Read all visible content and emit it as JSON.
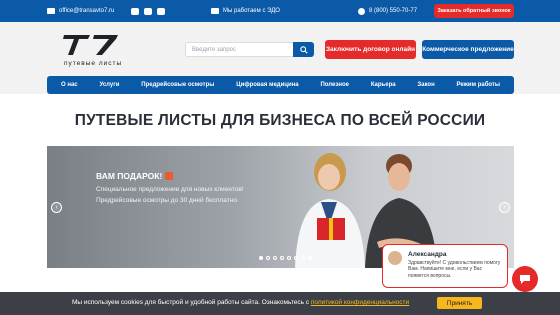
{
  "topbar": {
    "email": "office@transavto7.ru",
    "edo": "Мы работаем с ЭДО",
    "phone": "8 (800) 550-70-77",
    "callback": "Заказать обратный звонок"
  },
  "header": {
    "logo_text": "Т7",
    "logo_sub": "путевые листы",
    "search_placeholder": "Введите запрос",
    "contract_button": "Заключить договор онлайн",
    "offer_button": "Коммерческое предложение"
  },
  "nav": {
    "items": [
      "О нас",
      "Услуги",
      "Предрейсовые осмотры",
      "Цифровая медицина",
      "Полезное",
      "Карьера",
      "Закон",
      "Режим работы"
    ]
  },
  "main": {
    "title": "ПУТЕВЫЕ ЛИСТЫ ДЛЯ БИЗНЕСА ПО ВСЕЙ РОССИИ"
  },
  "banner": {
    "heading": "ВАМ ПОДАРОК!",
    "line1": "Специальное предложение для новых клиентов!",
    "line2": "Предрейсовые осмотры до 30 дней бесплатно.",
    "prev": "‹",
    "next": "›",
    "slide_count": 8,
    "active_slide": 1
  },
  "chat": {
    "name": "Александра",
    "message": "Здравствуйте! С удовольствием помогу Вам. Напишите мне, если у Вас появятся вопросы."
  },
  "cookie": {
    "text": "Мы используем cookies для быстрой и удобной работы сайта. Ознакомьтесь с ",
    "link": "политикой конфиденциальности",
    "accept": "Принять"
  },
  "colors": {
    "brand_blue": "#0b5aa8",
    "accent_red": "#e52a2a",
    "cookie_bg": "#3c4046",
    "accept_yellow": "#f5b71b"
  }
}
